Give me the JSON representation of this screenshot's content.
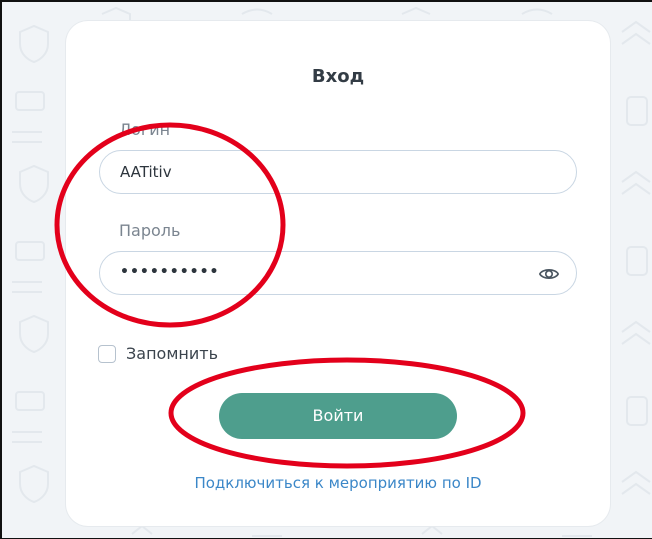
{
  "login_form": {
    "title": "Вход",
    "login_label": "Логин",
    "login_value": "AATitiv",
    "password_label": "Пароль",
    "password_value": "••••••••••",
    "show_password_icon": "eye-icon",
    "remember_label": "Запомнить",
    "remember_checked": false,
    "submit_label": "Войти",
    "join_by_id_link": "Подключиться к мероприятию по ID"
  },
  "colors": {
    "accent_button": "#4e9e8d",
    "link": "#3b87c8",
    "annotation": "#e3001b",
    "background": "#f1f4f7"
  }
}
